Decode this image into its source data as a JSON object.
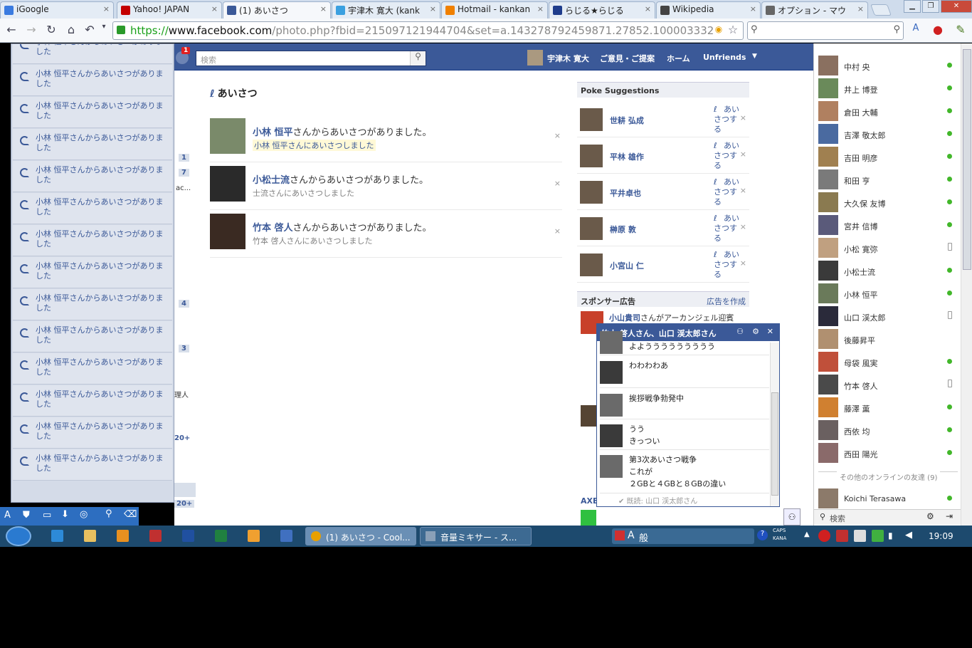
{
  "browser": {
    "tabs": [
      {
        "title": "iGoogle",
        "color": "#3a7be0"
      },
      {
        "title": "Yahoo! JAPAN",
        "color": "#c40000"
      },
      {
        "title": "(1) あいさつ",
        "color": "#3b5998"
      },
      {
        "title": "宇津木 寛大 (kank",
        "color": "#3aa0e0"
      },
      {
        "title": "Hotmail - kankan",
        "color": "#f08000"
      },
      {
        "title": "らじる★らじる",
        "color": "#1e3c8c"
      },
      {
        "title": "Wikipedia",
        "color": "#444444"
      },
      {
        "title": "オプション - マウ",
        "color": "#666666"
      }
    ],
    "url_scheme": "https://",
    "url_host": "www.facebook.com",
    "url_path": "/photo.php?fbid=215097121944704&set=a.143278792459871.27852.100003332"
  },
  "fb": {
    "search_placeholder": "検索",
    "notif_count": "1",
    "nav": {
      "user": "宇津木 寛大",
      "feedback": "ご意見・ご提案",
      "home": "ホーム",
      "unfriends": "Unfriends"
    },
    "page_title": "あいさつ",
    "pokes": [
      {
        "name": "小林 恒平",
        "suffix": "さんからあいさつがありました。",
        "sub": "小林 恒平さんにあいさつしました",
        "highlight": true
      },
      {
        "name": "小松士流",
        "suffix": "さんからあいさつがありました。",
        "sub": "士流さんにあいさつしました",
        "highlight": false
      },
      {
        "name": "竹本 啓人",
        "suffix": "さんからあいさつがありました。",
        "sub": "竹本 啓人さんにあいさつしました",
        "highlight": false
      }
    ],
    "suggestions_title": "Poke Suggestions",
    "suggestions": [
      "世耕 弘成",
      "平林 雄作",
      "平井卓也",
      "榊原 敦",
      "小宮山 仁"
    ],
    "poke_action": "あいさつする",
    "sponsored_title": "スポンサー広告",
    "create_ad": "広告を作成",
    "ad_name": "小山貴司",
    "ad_text": "さんがアーカンジェル迎賓",
    "ad_axe": "AXE",
    "left_counts": [
      "1",
      "7",
      "4",
      "3",
      "20+",
      "20+"
    ],
    "left_fragments": [
      "ac...",
      "理人"
    ]
  },
  "notifications": {
    "text": "小林 恒平さんからあいさつがありました",
    "count": 14
  },
  "chat": {
    "title": "竹本 啓人さん、山口 渓太郎さん",
    "messages": [
      {
        "text": "よよううううううううう"
      },
      {
        "text": "わわわわあ"
      },
      {
        "text": "挨拶戦争勃発中"
      },
      {
        "text": "うう\nきっつい"
      },
      {
        "text": "第3次あいさつ戦争\nこれが\n２GBと４GBと８GBの違い"
      }
    ],
    "read_receipt": "既読: 山口 渓太郎さん"
  },
  "sidebar": {
    "friends": [
      {
        "name": "中村 央",
        "status": "online"
      },
      {
        "name": "井上 博登",
        "status": "online"
      },
      {
        "name": "倉田 大輔",
        "status": "online"
      },
      {
        "name": "吉澤 敬太郎",
        "status": "online"
      },
      {
        "name": "吉田 明彦",
        "status": "online"
      },
      {
        "name": "和田 亨",
        "status": "online"
      },
      {
        "name": "大久保 友博",
        "status": "online"
      },
      {
        "name": "宮井 信博",
        "status": "online"
      },
      {
        "name": "小松 寛弥",
        "status": "mobile"
      },
      {
        "name": "小松士流",
        "status": "online"
      },
      {
        "name": "小林 恒平",
        "status": "online"
      },
      {
        "name": "山口 渓太郎",
        "status": "mobile"
      },
      {
        "name": "後藤昇平",
        "status": "none"
      },
      {
        "name": "母袋 風実",
        "status": "online"
      },
      {
        "name": "竹本 啓人",
        "status": "mobile"
      },
      {
        "name": "藤澤 薫",
        "status": "online"
      },
      {
        "name": "西依 均",
        "status": "online"
      },
      {
        "name": "西田 陽光",
        "status": "online"
      }
    ],
    "other_online": "その他のオンラインの友達 (9)",
    "extra_friend": "Koichi Terasawa",
    "search_placeholder": "検索"
  },
  "taskbar": {
    "tasks": [
      "(1) あいさつ - Cool...",
      "音量ミキサー - ス..."
    ],
    "ime": "般",
    "caps": "CAPS",
    "kana": "KANA",
    "clock": "19:09"
  }
}
